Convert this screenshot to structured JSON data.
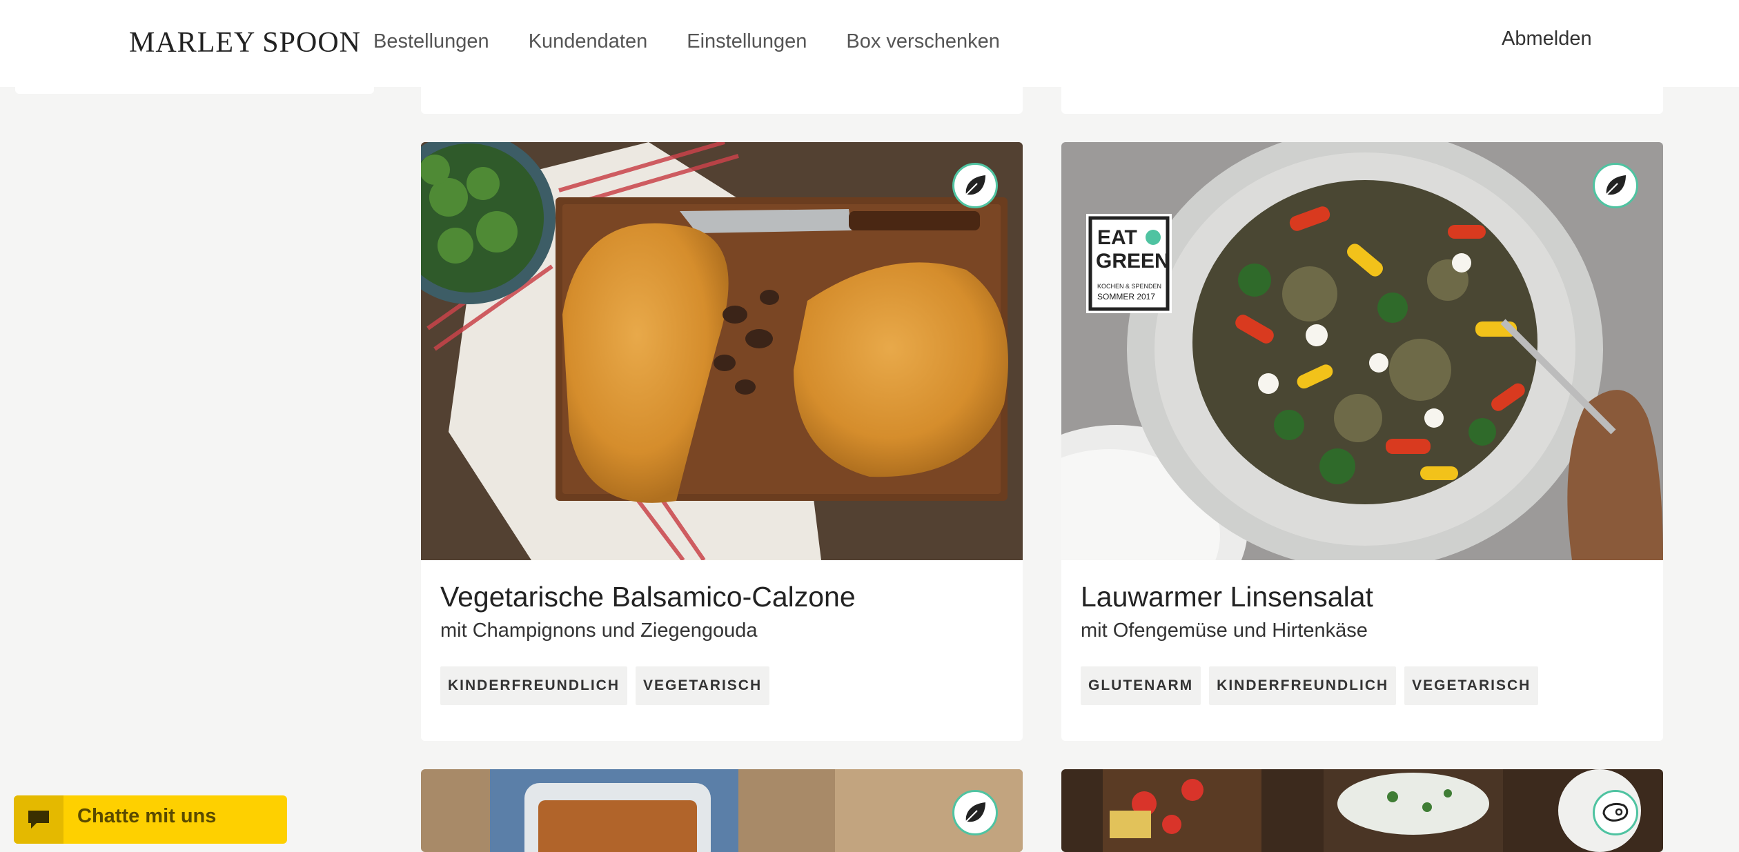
{
  "header": {
    "logo_text": "MARLEY SPOON",
    "nav": [
      "Bestellungen",
      "Kundendaten",
      "Einstellungen",
      "Box verschenken"
    ],
    "logout_label": "Abmelden"
  },
  "recipes": [
    {
      "title": "Vegetarische Balsamico-Calzone",
      "subtitle": "mit Champignons und Ziegengouda",
      "tags": [
        "KINDERFREUNDLICH",
        "VEGETARISCH"
      ],
      "badge_icon": "leaf-icon"
    },
    {
      "title": "Lauwarmer Linsensalat",
      "subtitle": "mit Ofengemüse und Hirtenkäse",
      "tags": [
        "GLUTENARM",
        "KINDERFREUNDLICH",
        "VEGETARISCH"
      ],
      "badge_icon": "leaf-icon",
      "image_overlay": {
        "line1": "EAT",
        "line2": "GREEN",
        "line3": "KOCHEN & SPENDEN",
        "line4": "SOMMER 2017"
      }
    }
  ],
  "partial_cards_badges": [
    "leaf-icon",
    "meat-icon"
  ],
  "chat": {
    "label": "Chatte mit uns",
    "icon": "chat-bubble-icon"
  },
  "colors": {
    "accent_badge": "#4fc3a1",
    "chat_bg": "#fed000",
    "page_bg": "#f5f5f4"
  }
}
